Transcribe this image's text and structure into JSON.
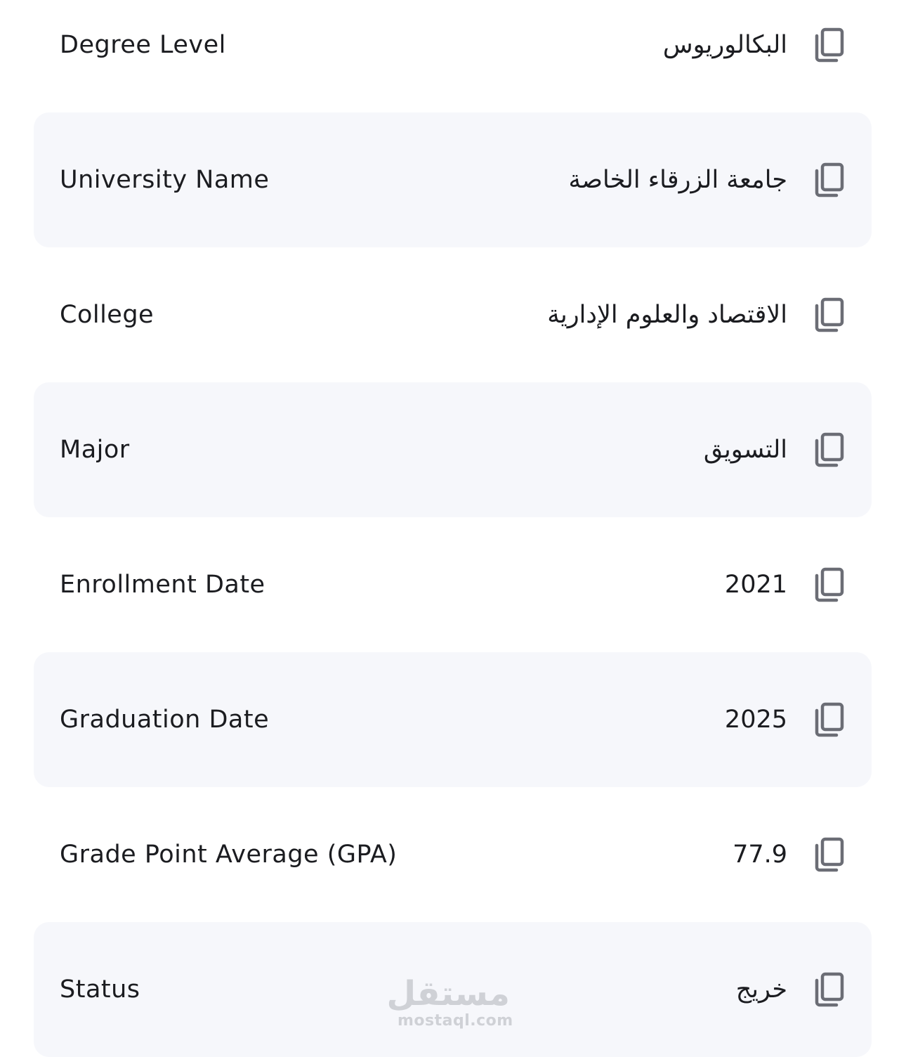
{
  "fields": [
    {
      "label": "Degree Level",
      "value": "البكالوريوس",
      "rtl": true
    },
    {
      "label": "University Name",
      "value": "جامعة الزرقاء الخاصة",
      "rtl": true
    },
    {
      "label": "College",
      "value": "الاقتصاد والعلوم الإدارية",
      "rtl": true
    },
    {
      "label": "Major",
      "value": "التسويق",
      "rtl": true
    },
    {
      "label": "Enrollment Date",
      "value": "2021",
      "rtl": false
    },
    {
      "label": "Graduation Date",
      "value": "2025",
      "rtl": false
    },
    {
      "label": "Grade Point Average (GPA)",
      "value": "77.9",
      "rtl": false
    },
    {
      "label": "Status",
      "value": "خريج",
      "rtl": true
    }
  ],
  "icons": {
    "copy": "copy-icon"
  },
  "colors": {
    "row_shade": "#f6f7fb",
    "icon": "#6b6d75",
    "text": "#1b1c20"
  },
  "watermark": {
    "arabic": "مستقل",
    "latin": "mostaql.com"
  }
}
